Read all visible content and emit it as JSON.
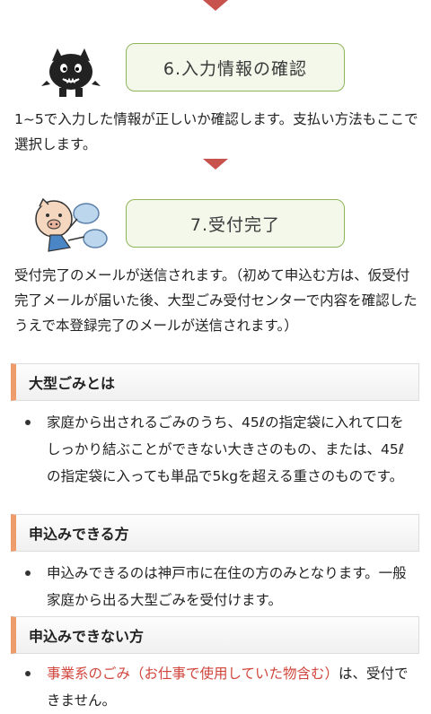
{
  "steps": [
    {
      "title": "6.入力情報の確認",
      "desc": "1~5で入力した情報が正しいか確認します。支払い方法もここで選択します。"
    },
    {
      "title": "7.受付完了",
      "desc": "受付完了のメールが送信されます。（初めて申込む方は、仮受付完了メールが届いた後、大型ごみ受付センターで内容を確認したうえで本登録完了のメールが送信されます。）"
    }
  ],
  "sections": [
    {
      "heading": "大型ごみとは",
      "text": "家庭から出されるごみのうち、45ℓの指定袋に入れて口をしっかり結ぶことができない大きさのもの、または、45ℓの指定袋に入っても単品で5kgを超える重さのものです。"
    },
    {
      "heading": "申込みできる方",
      "text": "申込みできるのは神戸市に在住の方のみとなります。一般家庭から出る大型ごみを受付けます。"
    },
    {
      "heading": "申込みできない方",
      "red_text": "事業系のごみ（お仕事で使用していた物含む）",
      "text": "は、受付できません。"
    }
  ],
  "icons": [
    "black-mascot-icon",
    "pig-mascot-with-bags-icon",
    "arrow-down-icon"
  ],
  "colors": {
    "accent_red": "#c8524c",
    "box_border": "#8fb55a",
    "box_bg": "#f3f8ea",
    "heading_bar": "#ee9c6c",
    "link_red": "#d0463c"
  }
}
